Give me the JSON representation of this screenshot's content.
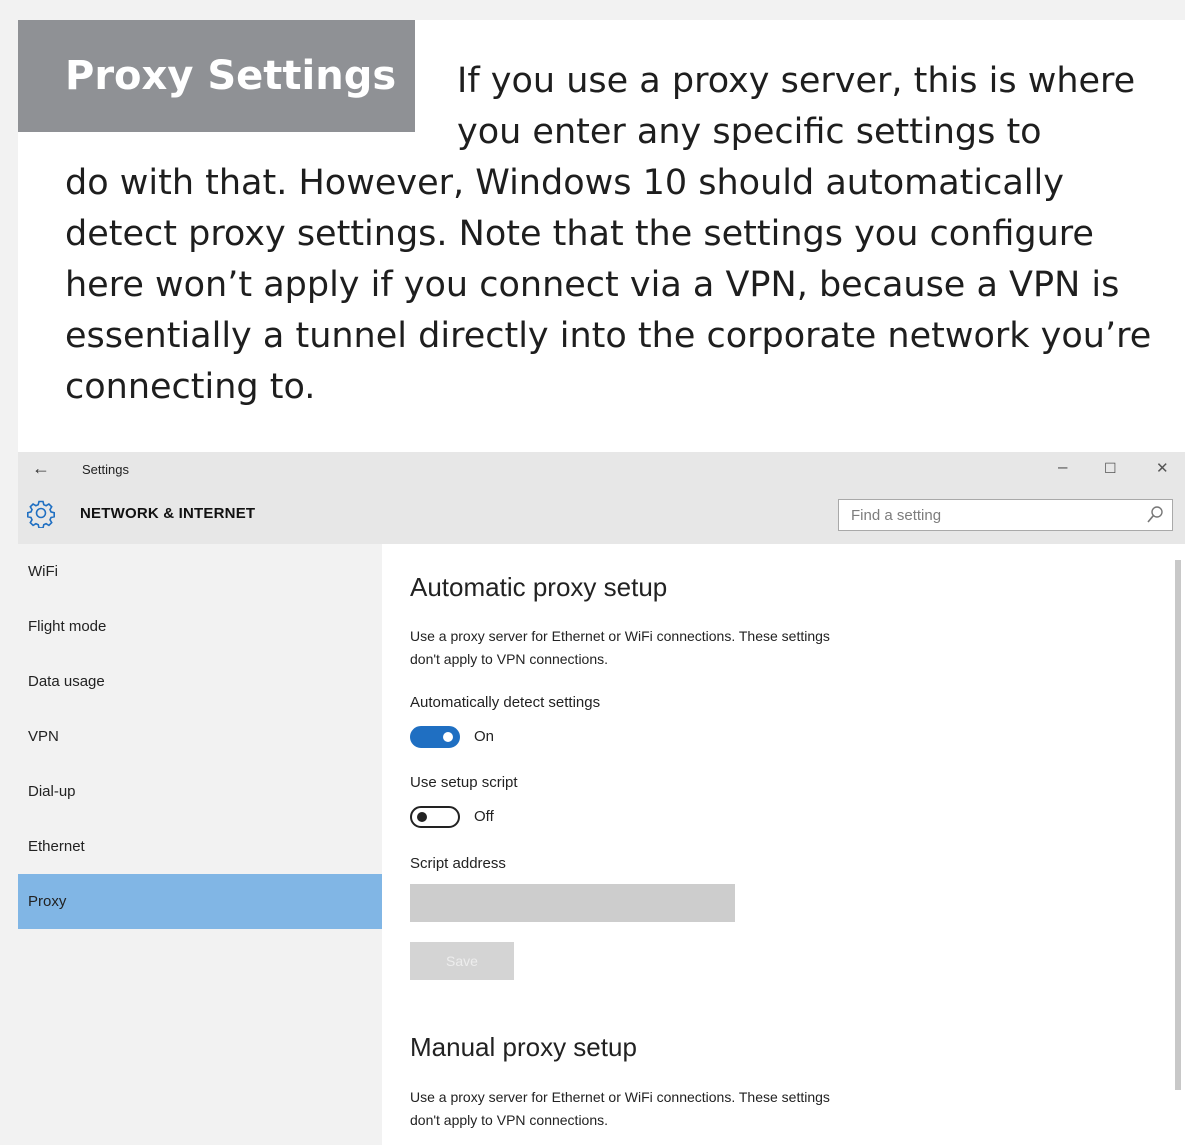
{
  "article": {
    "title": "Proxy Settings",
    "intro_first": "If you use a proxy server, this is where you enter any specific settings to",
    "intro_rest": "do with that. However, Windows 10 should automatically detect proxy settings. Note that the settings you configure here won’t apply if you connect via a VPN, because a VPN is essentially a tunnel directly into the corporate network you’re connecting to."
  },
  "window": {
    "app_title": "Settings",
    "back_glyph": "←",
    "min_glyph": "–",
    "max_glyph": "☐",
    "close_glyph": "✕",
    "section_title": "NETWORK & INTERNET",
    "search_placeholder": "Find a setting",
    "search_value": ""
  },
  "sidebar": {
    "items": [
      {
        "label": "WiFi",
        "selected": false
      },
      {
        "label": "Flight mode",
        "selected": false
      },
      {
        "label": "Data usage",
        "selected": false
      },
      {
        "label": "VPN",
        "selected": false
      },
      {
        "label": "Dial-up",
        "selected": false
      },
      {
        "label": "Ethernet",
        "selected": false
      },
      {
        "label": "Proxy",
        "selected": true
      }
    ]
  },
  "content": {
    "auto_heading": "Automatic proxy setup",
    "auto_desc_line1": "Use a proxy server for Ethernet or WiFi connections. These settings",
    "auto_desc_line2": "don't apply to VPN connections.",
    "auto_detect_label": "Automatically detect settings",
    "auto_detect_state": "On",
    "setup_script_label": "Use setup script",
    "setup_script_state": "Off",
    "script_address_label": "Script address",
    "script_address_value": "",
    "save_label": "Save",
    "manual_heading": "Manual proxy setup",
    "manual_desc_line1": "Use a proxy server for Ethernet or WiFi connections. These settings",
    "manual_desc_line2": "don't apply to VPN connections."
  },
  "colors": {
    "title_box": "#8f9195",
    "selected_nav": "#81b6e5",
    "toggle_on": "#1f6fc2",
    "chrome": "#e7e7e7"
  }
}
